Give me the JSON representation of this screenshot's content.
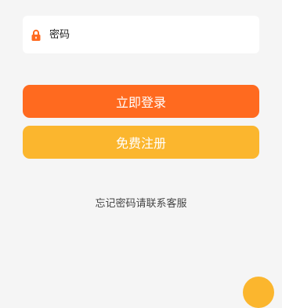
{
  "password_field": {
    "placeholder": "密码",
    "icon": "lock-icon",
    "icon_color": "#ff6a1f"
  },
  "buttons": {
    "login_label": "立即登录",
    "register_label": "免费注册"
  },
  "forgot_text": "忘记密码请联系客服",
  "colors": {
    "primary": "#ff6a1f",
    "secondary": "#fbb62e",
    "background": "#f5f5f5",
    "field_background": "#ffffff"
  }
}
